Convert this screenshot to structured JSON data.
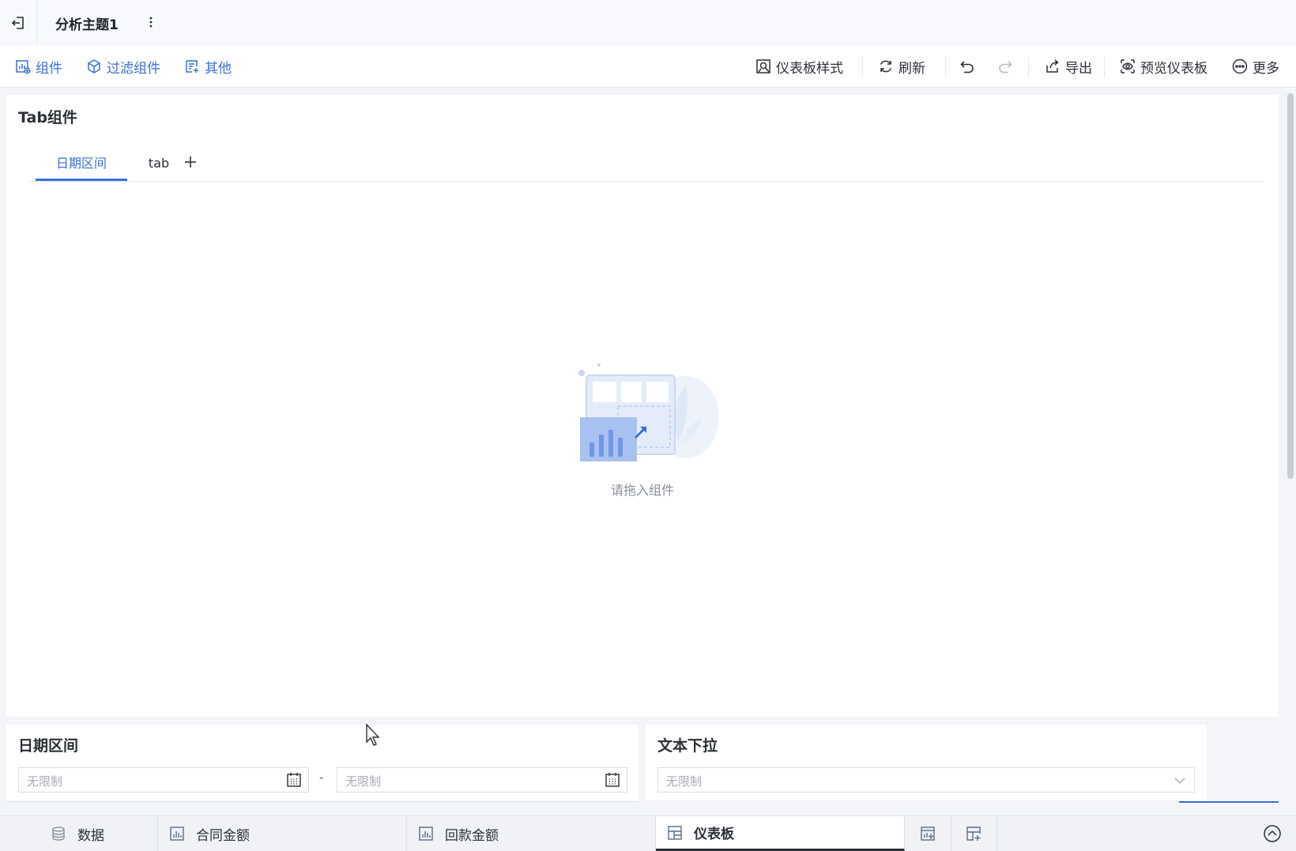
{
  "header": {
    "title": "分析主题1"
  },
  "toolbar": {
    "component": "组件",
    "filter_component": "过滤组件",
    "other": "其他",
    "dashboard_style": "仪表板样式",
    "refresh": "刷新",
    "export": "导出",
    "preview_dashboard": "预览仪表板",
    "more": "更多"
  },
  "tab_card": {
    "title": "Tab组件",
    "tabs": [
      {
        "label": "日期区间",
        "active": true
      },
      {
        "label": "tab",
        "active": false
      }
    ],
    "empty_text": "请拖入组件"
  },
  "date_filter": {
    "title": "日期区间",
    "start_placeholder": "无限制",
    "separator": "-",
    "end_placeholder": "无限制"
  },
  "text_filter": {
    "title": "文本下拉",
    "placeholder": "无限制"
  },
  "bottom_tabs": [
    {
      "label": "数据",
      "icon": "database-icon"
    },
    {
      "label": "合同金额",
      "icon": "bar-chart-icon"
    },
    {
      "label": "回款金额",
      "icon": "bar-chart-icon"
    },
    {
      "label": "仪表板",
      "icon": "dashboard-icon",
      "active": true
    }
  ],
  "colors": {
    "accent": "#3a6fd8",
    "text": "#2b2f36",
    "placeholder": "#a8abb2"
  }
}
